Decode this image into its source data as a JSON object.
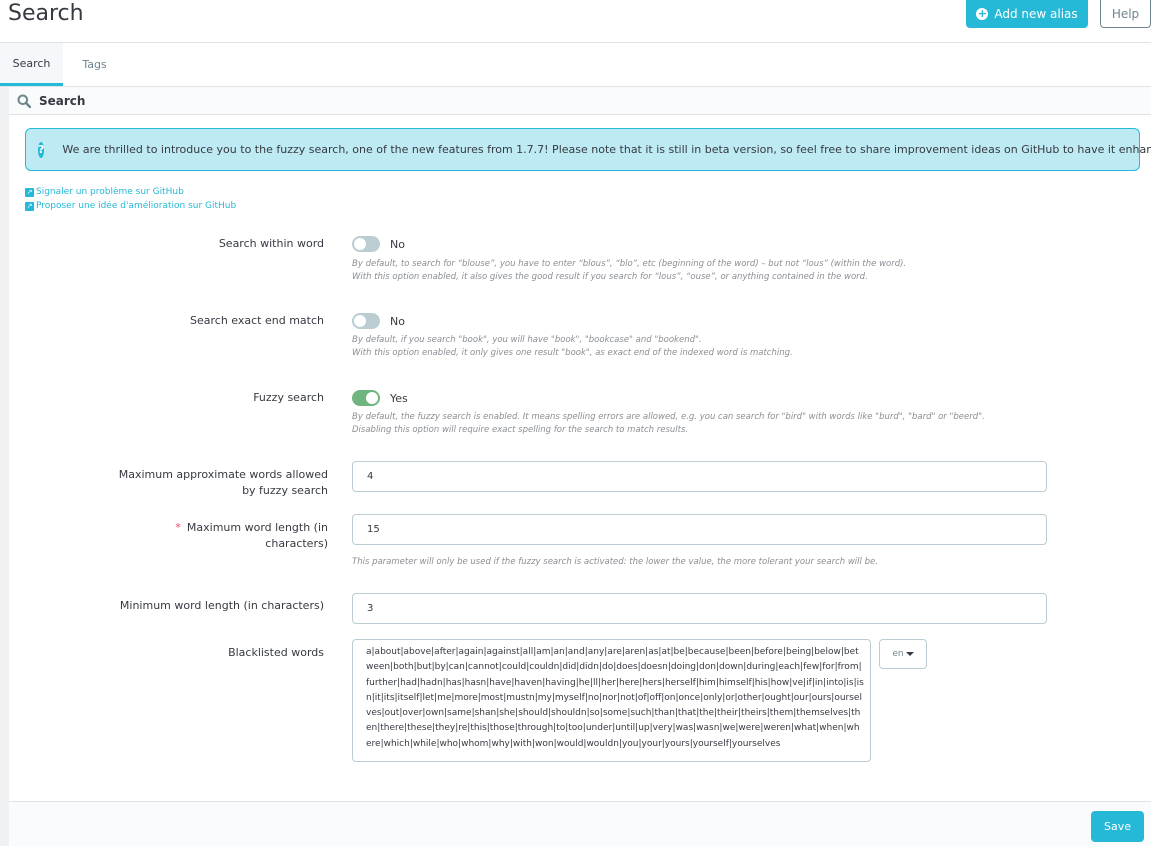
{
  "header": {
    "title": "Search",
    "add_button_label": "Add new alias",
    "help_button_label": "Help"
  },
  "tabs": [
    {
      "label": "Search",
      "active": true
    },
    {
      "label": "Tags",
      "active": false
    }
  ],
  "panel": {
    "title": "Search",
    "alert_text": "We are thrilled to introduce you to the fuzzy search, one of the new features from 1.7.7! Please note that it is still in beta version, so feel free to share improvement ideas on GitHub to have it enhanced.",
    "links": [
      "Signaler un problème sur GitHub",
      "Proposer une idée d'amélioration sur GitHub"
    ]
  },
  "form": {
    "search_within_word": {
      "label": "Search within word",
      "value": "No",
      "enabled": false,
      "help_1": "By default, to search for “blouse”, you have to enter “blous”, “blo”, etc (beginning of the word) – but not “lous” (within the word).",
      "help_2": "With this option enabled, it also gives the good result if you search for “lous”, “ouse”, or anything contained in the word."
    },
    "search_exact_end": {
      "label": "Search exact end match",
      "value": "No",
      "enabled": false,
      "help_1": "By default, if you search \"book\", you will have \"book\", \"bookcase\" and \"bookend\".",
      "help_2": "With this option enabled, it only gives one result \"book\", as exact end of the indexed word is matching."
    },
    "fuzzy_search": {
      "label": "Fuzzy search",
      "value": "Yes",
      "enabled": true,
      "help_1": "By default, the fuzzy search is enabled. It means spelling errors are allowed, e.g. you can search for \"bird\" with words like \"burd\", \"bard\" or \"beerd\".",
      "help_2": "Disabling this option will require exact spelling for the search to match results."
    },
    "max_approx_words": {
      "label_line1": "Maximum approximate words allowed",
      "label_line2": "by fuzzy search",
      "value": "4"
    },
    "max_word_length": {
      "required_mark": "*",
      "label_line1": "Maximum word length (in",
      "label_line2": "characters)",
      "value": "15",
      "help": "This parameter will only be used if the fuzzy search is activated: the lower the value, the more tolerant your search will be."
    },
    "min_word_length": {
      "label": "Minimum word length (in characters)",
      "value": "3"
    },
    "blacklisted_words": {
      "label": "Blacklisted words",
      "value": "a|about|above|after|again|against|all|am|an|and|any|are|aren|as|at|be|because|been|before|being|below|between|both|but|by|can|cannot|could|couldn|did|didn|do|does|doesn|doing|don|down|during|each|few|for|from|further|had|hadn|has|hasn|have|haven|having|he|ll|her|here|hers|herself|him|himself|his|how|ve|if|in|into|is|isn|it|its|itself|let|me|more|most|mustn|my|myself|no|nor|not|of|off|on|once|only|or|other|ought|our|ours|ourselves|out|over|own|same|shan|she|should|shouldn|so|some|such|than|that|the|their|theirs|them|themselves|then|there|these|they|re|this|those|through|to|too|under|until|up|very|was|wasn|we|were|weren|what|when|where|which|while|who|whom|why|with|won|would|wouldn|you|your|yours|yourself|yourselves",
      "language": "en"
    }
  },
  "footer": {
    "save_label": "Save"
  },
  "colors": {
    "accent": "#25b9d7",
    "switch_on": "#70b580",
    "switch_off": "#bbcdd2",
    "alert_bg": "#beeaf3",
    "required": "#e4506c"
  }
}
